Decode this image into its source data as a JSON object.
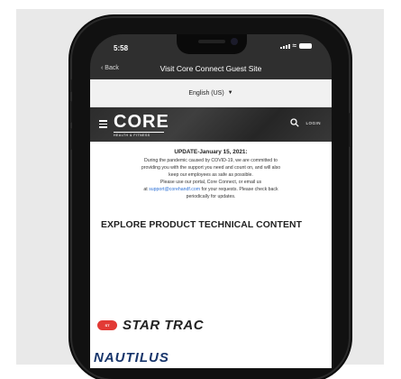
{
  "status": {
    "time": "5:58"
  },
  "navbar": {
    "back_label": "Back",
    "title": "Visit Core Connect Guest Site"
  },
  "language": {
    "selected": "English (US)"
  },
  "brand": {
    "name": "CORE",
    "tagline": "HEALTH & FITNESS",
    "login_label": "LOGIN"
  },
  "update": {
    "heading": "UPDATE-January 15, 2021:",
    "line1": "During the pandemic caused by COVID-19, we are committed to",
    "line2": "providing you with the support you need and count on, and will also",
    "line3": "keep our employees as safe as possible.",
    "line4": "Please use our portal, Core Connect, or email us",
    "line5_pre": "at",
    "email": "support@corehandf.com",
    "line5_post": "for your requests. Please check back",
    "line6": "periodically for updates."
  },
  "explore_heading": "EXPLORE PRODUCT TECHNICAL CONTENT",
  "brands": {
    "star_trac": "STAR TRAC",
    "star_trac_badge": "ST",
    "nautilus": "NAUTILUS"
  },
  "colors": {
    "star_trac_red": "#e23a35",
    "nautilus_blue": "#17356b",
    "link_blue": "#2a6fd6"
  }
}
